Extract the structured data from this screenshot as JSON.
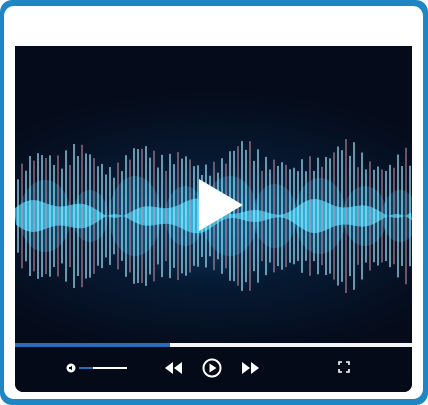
{
  "player": {
    "progress": 0.39,
    "volume": 0.3,
    "state": "paused"
  },
  "icons": {
    "big_play": "play-icon",
    "volume": "speaker-icon",
    "rewind": "rewind-icon",
    "play": "play-circle-icon",
    "forward": "fast-forward-icon",
    "fullscreen": "fullscreen-icon"
  },
  "colors": {
    "frame": "#1e86c4",
    "background": "#060c1c",
    "wave": "#3cc8f0",
    "accent_bars": "#e09bb0",
    "progress": "#2b6cb6",
    "track": "#f2f4f7",
    "icon": "#ffffff"
  }
}
